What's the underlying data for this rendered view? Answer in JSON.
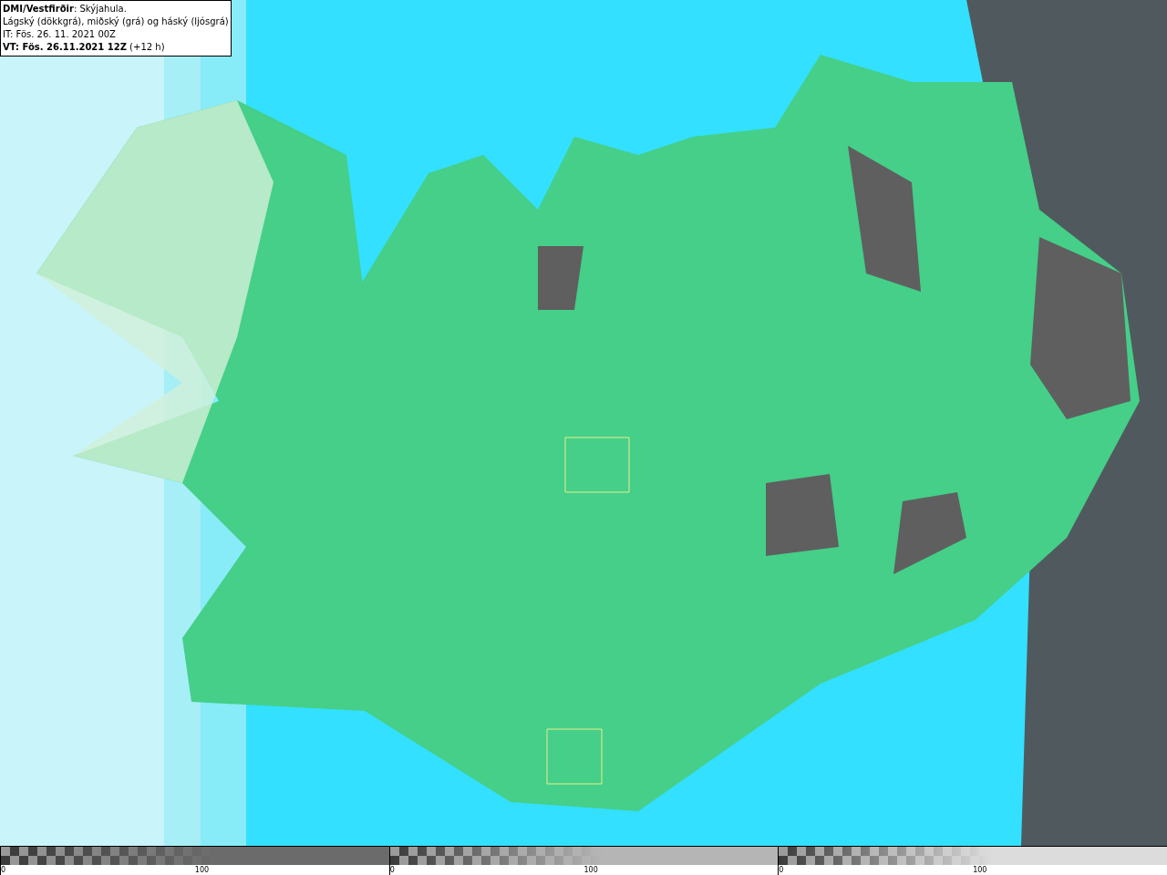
{
  "info_box": {
    "lines": [
      "**DMI/Vestfirðir**: Skýjahula.",
      "Lágský (dökkgrá), miðský (grá) og háský (ljósgrá)",
      "IT: Fös. 26. 11. 2021 00Z",
      "**VT: Fös. 26.11.2021 12Z** (+12 h)"
    ]
  },
  "legend": [
    {
      "color": "#6b6b6b",
      "min_label": "0",
      "max_label": "100"
    },
    {
      "color": "#b5b5b5",
      "min_label": "0",
      "max_label": "100"
    },
    {
      "color": "#dcdcdc",
      "min_label": "0",
      "max_label": "100"
    }
  ]
}
